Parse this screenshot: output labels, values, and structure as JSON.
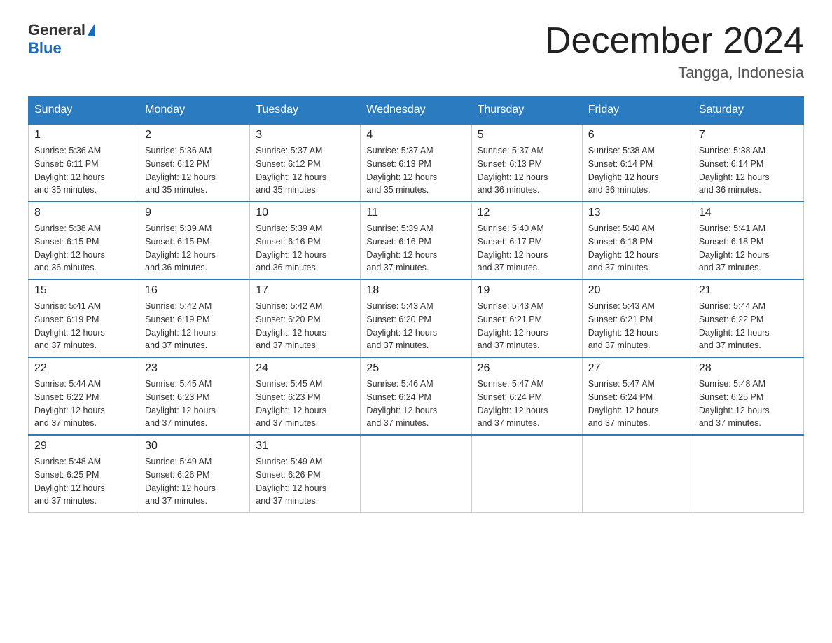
{
  "header": {
    "logo_general": "General",
    "logo_blue": "Blue",
    "title": "December 2024",
    "subtitle": "Tangga, Indonesia"
  },
  "days_of_week": [
    "Sunday",
    "Monday",
    "Tuesday",
    "Wednesday",
    "Thursday",
    "Friday",
    "Saturday"
  ],
  "weeks": [
    [
      {
        "day": "1",
        "sunrise": "5:36 AM",
        "sunset": "6:11 PM",
        "daylight": "12 hours and 35 minutes."
      },
      {
        "day": "2",
        "sunrise": "5:36 AM",
        "sunset": "6:12 PM",
        "daylight": "12 hours and 35 minutes."
      },
      {
        "day": "3",
        "sunrise": "5:37 AM",
        "sunset": "6:12 PM",
        "daylight": "12 hours and 35 minutes."
      },
      {
        "day": "4",
        "sunrise": "5:37 AM",
        "sunset": "6:13 PM",
        "daylight": "12 hours and 35 minutes."
      },
      {
        "day": "5",
        "sunrise": "5:37 AM",
        "sunset": "6:13 PM",
        "daylight": "12 hours and 36 minutes."
      },
      {
        "day": "6",
        "sunrise": "5:38 AM",
        "sunset": "6:14 PM",
        "daylight": "12 hours and 36 minutes."
      },
      {
        "day": "7",
        "sunrise": "5:38 AM",
        "sunset": "6:14 PM",
        "daylight": "12 hours and 36 minutes."
      }
    ],
    [
      {
        "day": "8",
        "sunrise": "5:38 AM",
        "sunset": "6:15 PM",
        "daylight": "12 hours and 36 minutes."
      },
      {
        "day": "9",
        "sunrise": "5:39 AM",
        "sunset": "6:15 PM",
        "daylight": "12 hours and 36 minutes."
      },
      {
        "day": "10",
        "sunrise": "5:39 AM",
        "sunset": "6:16 PM",
        "daylight": "12 hours and 36 minutes."
      },
      {
        "day": "11",
        "sunrise": "5:39 AM",
        "sunset": "6:16 PM",
        "daylight": "12 hours and 37 minutes."
      },
      {
        "day": "12",
        "sunrise": "5:40 AM",
        "sunset": "6:17 PM",
        "daylight": "12 hours and 37 minutes."
      },
      {
        "day": "13",
        "sunrise": "5:40 AM",
        "sunset": "6:18 PM",
        "daylight": "12 hours and 37 minutes."
      },
      {
        "day": "14",
        "sunrise": "5:41 AM",
        "sunset": "6:18 PM",
        "daylight": "12 hours and 37 minutes."
      }
    ],
    [
      {
        "day": "15",
        "sunrise": "5:41 AM",
        "sunset": "6:19 PM",
        "daylight": "12 hours and 37 minutes."
      },
      {
        "day": "16",
        "sunrise": "5:42 AM",
        "sunset": "6:19 PM",
        "daylight": "12 hours and 37 minutes."
      },
      {
        "day": "17",
        "sunrise": "5:42 AM",
        "sunset": "6:20 PM",
        "daylight": "12 hours and 37 minutes."
      },
      {
        "day": "18",
        "sunrise": "5:43 AM",
        "sunset": "6:20 PM",
        "daylight": "12 hours and 37 minutes."
      },
      {
        "day": "19",
        "sunrise": "5:43 AM",
        "sunset": "6:21 PM",
        "daylight": "12 hours and 37 minutes."
      },
      {
        "day": "20",
        "sunrise": "5:43 AM",
        "sunset": "6:21 PM",
        "daylight": "12 hours and 37 minutes."
      },
      {
        "day": "21",
        "sunrise": "5:44 AM",
        "sunset": "6:22 PM",
        "daylight": "12 hours and 37 minutes."
      }
    ],
    [
      {
        "day": "22",
        "sunrise": "5:44 AM",
        "sunset": "6:22 PM",
        "daylight": "12 hours and 37 minutes."
      },
      {
        "day": "23",
        "sunrise": "5:45 AM",
        "sunset": "6:23 PM",
        "daylight": "12 hours and 37 minutes."
      },
      {
        "day": "24",
        "sunrise": "5:45 AM",
        "sunset": "6:23 PM",
        "daylight": "12 hours and 37 minutes."
      },
      {
        "day": "25",
        "sunrise": "5:46 AM",
        "sunset": "6:24 PM",
        "daylight": "12 hours and 37 minutes."
      },
      {
        "day": "26",
        "sunrise": "5:47 AM",
        "sunset": "6:24 PM",
        "daylight": "12 hours and 37 minutes."
      },
      {
        "day": "27",
        "sunrise": "5:47 AM",
        "sunset": "6:24 PM",
        "daylight": "12 hours and 37 minutes."
      },
      {
        "day": "28",
        "sunrise": "5:48 AM",
        "sunset": "6:25 PM",
        "daylight": "12 hours and 37 minutes."
      }
    ],
    [
      {
        "day": "29",
        "sunrise": "5:48 AM",
        "sunset": "6:25 PM",
        "daylight": "12 hours and 37 minutes."
      },
      {
        "day": "30",
        "sunrise": "5:49 AM",
        "sunset": "6:26 PM",
        "daylight": "12 hours and 37 minutes."
      },
      {
        "day": "31",
        "sunrise": "5:49 AM",
        "sunset": "6:26 PM",
        "daylight": "12 hours and 37 minutes."
      },
      null,
      null,
      null,
      null
    ]
  ],
  "labels": {
    "sunrise_prefix": "Sunrise: ",
    "sunset_prefix": "Sunset: ",
    "daylight_prefix": "Daylight: "
  }
}
